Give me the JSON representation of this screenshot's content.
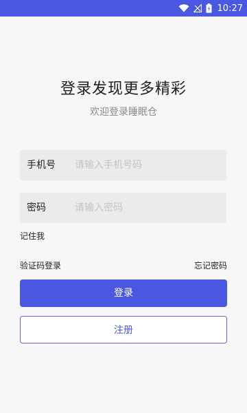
{
  "colors": {
    "accent": "#4a57e0",
    "background": "#f7f7f7",
    "field_background": "#ecebec",
    "placeholder": "#c4c4c4",
    "subtitle": "#8b8b8b"
  },
  "status_bar": {
    "time": "10:27",
    "icons": [
      "wifi-icon",
      "signal-icon",
      "battery-icon"
    ]
  },
  "header": {
    "title": "登录发现更多精彩",
    "subtitle": "欢迎登录睡眠仓"
  },
  "form": {
    "phone": {
      "label": "手机号",
      "placeholder": "请输入手机号码",
      "value": ""
    },
    "password": {
      "label": "密码",
      "placeholder": "请输入密码",
      "value": ""
    },
    "remember_label": "记住我",
    "sms_login_label": "验证码登录",
    "forgot_label": "忘记密码",
    "login_label": "登录",
    "register_label": "注册"
  }
}
